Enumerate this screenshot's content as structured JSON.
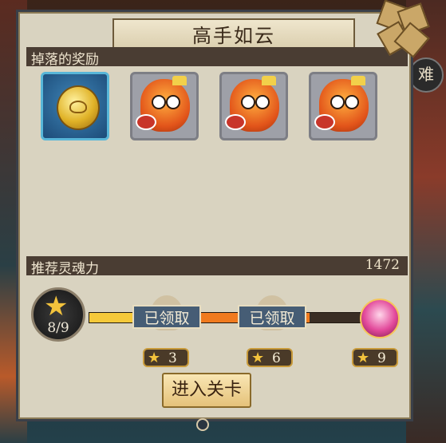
{
  "dialog": {
    "title": "高手如云",
    "drops_label": "掉落的奖励",
    "power_label": "推荐灵魂力",
    "power_value": "1472",
    "enter_button": "进入关卡",
    "side_tab": "难"
  },
  "rewards": [
    {
      "icon": "gold-coin-icon"
    },
    {
      "icon": "goldfish-icon"
    },
    {
      "icon": "goldfish-icon"
    },
    {
      "icon": "goldfish-icon"
    }
  ],
  "progress": {
    "stars": "8/9",
    "fraction": 0.889,
    "milestones": [
      {
        "status": "已领取",
        "stars": "3"
      },
      {
        "status": "已领取",
        "stars": "6"
      },
      {
        "status": "",
        "stars": "9",
        "icon": "pink-chest-icon"
      }
    ]
  },
  "colors": {
    "accent": "#f07a1e",
    "claimed_bg": "#465d75",
    "star": "#f3c33c"
  }
}
